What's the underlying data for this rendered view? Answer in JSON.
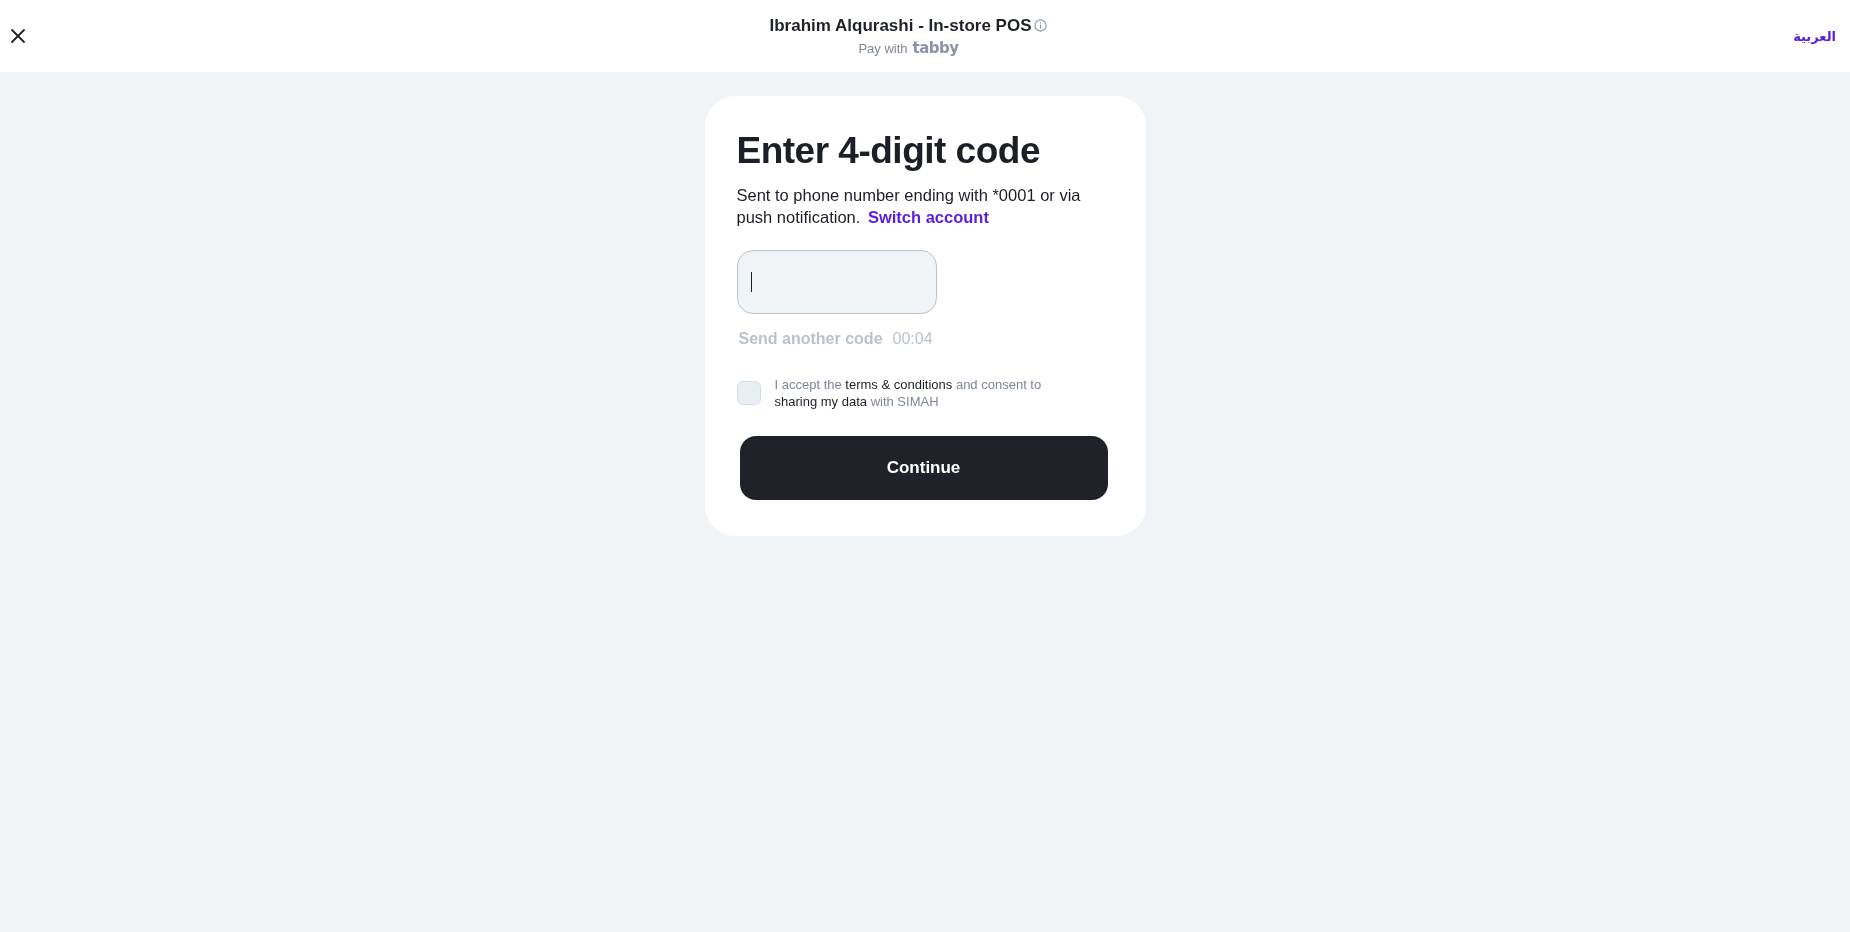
{
  "header": {
    "title": "Ibrahim Alqurashi - In-store POS",
    "subtitle": "Pay with",
    "brand": "tabby",
    "language_link": "العربية"
  },
  "card": {
    "heading": "Enter 4-digit code",
    "message": "Sent to phone number ending with *0001 or via push notification.",
    "switch_link": "Switch account",
    "code_field": {
      "focused": true
    },
    "resend": {
      "label": "Send another code",
      "timer": "00:04",
      "disabled": true
    },
    "consent": {
      "checked": false,
      "parts": [
        {
          "kind": "plain",
          "text": "I accept the"
        },
        {
          "kind": "link",
          "text": "terms & conditions"
        },
        {
          "kind": "plain",
          "text": "and consent to"
        },
        {
          "kind": "link",
          "text": "sharing my data"
        },
        {
          "kind": "plain",
          "text": "with SIMAH"
        }
      ]
    },
    "continue_button": "Continue"
  }
}
